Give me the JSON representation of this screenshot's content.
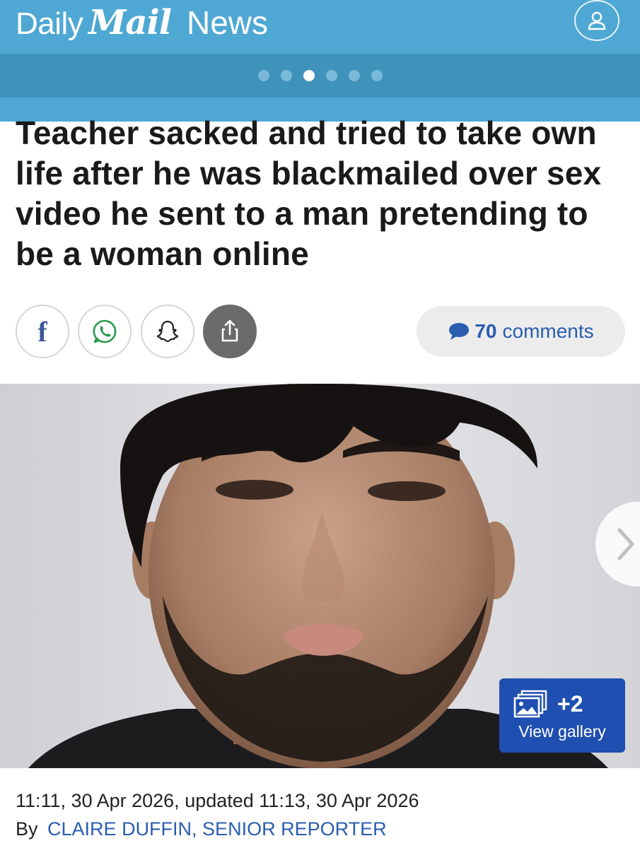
{
  "header": {
    "brand_daily": "Daily",
    "brand_mail": "Mail",
    "section": "News",
    "bg_color": "#4fa8d3",
    "account_icon": "user-icon"
  },
  "carousel": {
    "dot_count": 6,
    "active_index": 2
  },
  "article": {
    "headline": "Teacher sacked and tried to take own life after he was blackmailed over sex video he sent to a man pretending to be a woman online",
    "share": {
      "icons": [
        "facebook-icon",
        "whatsapp-icon",
        "snapchat-icon",
        "share-icon"
      ]
    },
    "comments": {
      "count": "70",
      "label": "comments",
      "icon": "comment-bubble-icon"
    },
    "image": {
      "next_icon": "chevron-right-icon",
      "gallery": {
        "count": "+2",
        "label": "View gallery",
        "icon": "gallery-icon"
      }
    },
    "timestamp": "11:11, 30 Apr 2026, updated 11:13, 30 Apr 2026",
    "byline_prefix": "By",
    "author": "CLAIRE DUFFIN, SENIOR REPORTER"
  },
  "colors": {
    "accent_blue": "#2a5db0",
    "gallery_blue": "#1f4fb0",
    "share_dark": "#6b6b6b"
  }
}
